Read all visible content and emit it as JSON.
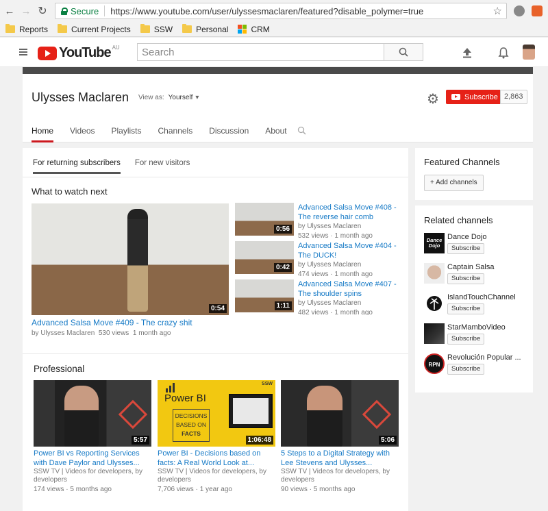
{
  "browser": {
    "secure_label": "Secure",
    "url": "https://www.youtube.com/user/ulyssesmaclaren/featured?disable_polymer=true",
    "bookmarks": [
      "Reports",
      "Current Projects",
      "SSW",
      "Personal",
      "CRM"
    ]
  },
  "header": {
    "logo_text": "YouTube",
    "region": "AU",
    "search_placeholder": "Search"
  },
  "channel": {
    "name": "Ulysses Maclaren",
    "view_as_label": "View as:",
    "view_as_value": "Yourself",
    "subscribe_label": "Subscribe",
    "subscriber_count": "2,863",
    "tabs": [
      "Home",
      "Videos",
      "Playlists",
      "Channels",
      "Discussion",
      "About"
    ]
  },
  "main": {
    "subtabs": [
      "For returning subscribers",
      "For new visitors"
    ],
    "watch_next_title": "What to watch next",
    "featured": {
      "title": "Advanced Salsa Move #409 - The crazy shit",
      "channel": "by Ulysses Maclaren",
      "views": "530 views",
      "age": "1 month ago",
      "duration": "0:54"
    },
    "side_videos": [
      {
        "title1": "Advanced Salsa Move #408 -",
        "title2": "The reverse hair comb",
        "channel": "by Ulysses Maclaren",
        "meta": "532 views · 1 month ago",
        "duration": "0:56"
      },
      {
        "title1": "Advanced Salsa Move #404 -",
        "title2": "The DUCK!",
        "channel": "by Ulysses Maclaren",
        "meta": "474 views · 1 month ago",
        "duration": "0:42"
      },
      {
        "title1": "Advanced Salsa Move #407 -",
        "title2": "The shoulder spins",
        "channel": "by Ulysses Maclaren",
        "meta": "482 views · 1 month ago",
        "duration": "1:11"
      }
    ],
    "professional_title": "Professional",
    "pro_videos": [
      {
        "title1": "Power BI vs Reporting Services",
        "title2": "with Dave Paylor and Ulysses...",
        "channel1": "SSW TV | Videos for developers, by",
        "channel2": "developers",
        "meta": "174 views · 5 months ago",
        "duration": "5:57"
      },
      {
        "title1": "Power BI - Decisions based on",
        "title2": "facts: A Real World Look at...",
        "channel1": "SSW TV | Videos for developers, by",
        "channel2": "developers",
        "meta": "7,706 views · 1 year ago",
        "duration": "1:06:48",
        "thumb_brand": "Power BI",
        "thumb_line1": "DECISIONS",
        "thumb_line2": "BASED ON",
        "thumb_line3": "FACTS",
        "thumb_tag": "SSW"
      },
      {
        "title1": "5 Steps to a Digital Strategy with",
        "title2": "Lee Stevens and Ulysses...",
        "channel1": "SSW TV | Videos for developers, by",
        "channel2": "developers",
        "meta": "90 views · 5 months ago",
        "duration": "5:06"
      }
    ]
  },
  "sidebar": {
    "featured_title": "Featured Channels",
    "add_channels_label": "+ Add channels",
    "related_title": "Related channels",
    "subscribe_label": "Subscribe",
    "related": [
      {
        "name": "Dance Dojo",
        "avatar_text": "Dance Dojo"
      },
      {
        "name": "Captain Salsa"
      },
      {
        "name": "IslandTouchChannel"
      },
      {
        "name": "StarMamboVideo"
      },
      {
        "name": "Revolución Popular ...",
        "avatar_text": "RPN"
      }
    ]
  },
  "colors": {
    "accent": "#e62117",
    "link": "#167ac6",
    "tab_underline": "#cc181e"
  }
}
